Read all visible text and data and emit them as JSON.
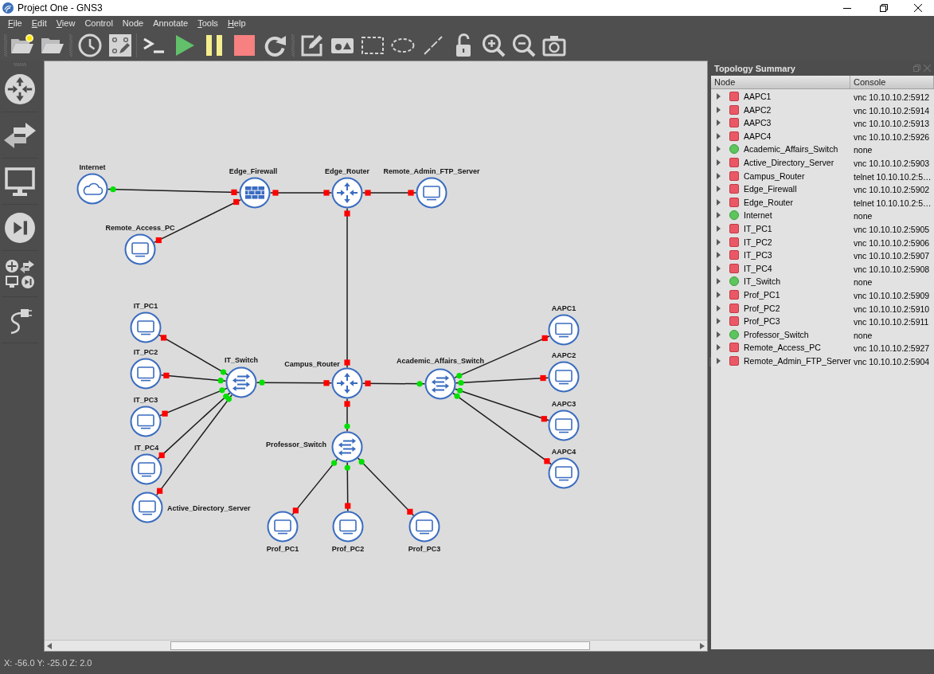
{
  "window": {
    "title": "Project One - GNS3"
  },
  "menu_bar": [
    {
      "label": "File",
      "mnemonic": true
    },
    {
      "label": "Edit",
      "mnemonic": true
    },
    {
      "label": "View",
      "mnemonic": true
    },
    {
      "label": "Control",
      "mnemonic": false
    },
    {
      "label": "Node",
      "mnemonic": false
    },
    {
      "label": "Annotate",
      "mnemonic": false
    },
    {
      "label": "Tools",
      "mnemonic": true
    },
    {
      "label": "Help",
      "mnemonic": true
    }
  ],
  "canvas": {
    "nodes": [
      {
        "name": "Internet",
        "kind": "cloud",
        "running": true,
        "selected": false
      },
      {
        "name": "Edge_Firewall",
        "kind": "firewall",
        "running": false,
        "selected": false
      },
      {
        "name": "Edge_Router",
        "kind": "router",
        "running": false,
        "selected": false
      },
      {
        "name": "Remote_Admin_FTP_Server",
        "kind": "pc",
        "running": false,
        "selected": false
      },
      {
        "name": "Remote_Access_PC",
        "kind": "pc",
        "running": false,
        "selected": false
      },
      {
        "name": "IT_PC1",
        "kind": "pc",
        "running": false,
        "selected": false
      },
      {
        "name": "AAPC1",
        "kind": "pc",
        "running": false,
        "selected": false
      },
      {
        "name": "IT_PC2",
        "kind": "pc",
        "running": false,
        "selected": false
      },
      {
        "name": "AAPC2",
        "kind": "pc",
        "running": false,
        "selected": false
      },
      {
        "name": "IT_Switch",
        "kind": "switch",
        "running": true,
        "selected": false
      },
      {
        "name": "Campus_Router",
        "kind": "router",
        "running": false,
        "selected": false
      },
      {
        "name": "Academic_Affairs_Switch",
        "kind": "switch",
        "running": true,
        "selected": false
      },
      {
        "name": "IT_PC3",
        "kind": "pc",
        "running": false,
        "selected": false
      },
      {
        "name": "AAPC3",
        "kind": "pc",
        "running": false,
        "selected": false
      },
      {
        "name": "Professor_Switch",
        "kind": "switch",
        "running": true,
        "selected": false
      },
      {
        "name": "IT_PC4",
        "kind": "pc",
        "running": false,
        "selected": false
      },
      {
        "name": "AAPC4",
        "kind": "pc",
        "running": false,
        "selected": false
      },
      {
        "name": "Active_Directory_Server",
        "kind": "pc",
        "running": false,
        "selected": false
      },
      {
        "name": "Prof_PC1",
        "kind": "pc",
        "running": false,
        "selected": false
      },
      {
        "name": "Prof_PC2",
        "kind": "pc",
        "running": false,
        "selected": false
      },
      {
        "name": "Prof_PC3",
        "kind": "pc",
        "running": false,
        "selected": false
      }
    ]
  },
  "topology_summary": {
    "title": "Topology Summary",
    "columns": [
      "Node",
      "Console"
    ],
    "rows": [
      {
        "node": "AAPC1",
        "console": "vnc 10.10.10.2:5912",
        "running": false,
        "expanded": false,
        "selected": false
      },
      {
        "node": "AAPC2",
        "console": "vnc 10.10.10.2:5914",
        "running": false,
        "expanded": false,
        "selected": false
      },
      {
        "node": "AAPC3",
        "console": "vnc 10.10.10.2:5913",
        "running": false,
        "expanded": false,
        "selected": false
      },
      {
        "node": "AAPC4",
        "console": "vnc 10.10.10.2:5926",
        "running": false,
        "expanded": false,
        "selected": false
      },
      {
        "node": "Academic_Affairs_Switch",
        "console": "none",
        "running": true,
        "expanded": false,
        "selected": false
      },
      {
        "node": "Active_Directory_Server",
        "console": "vnc 10.10.10.2:5903",
        "running": false,
        "expanded": false,
        "selected": false
      },
      {
        "node": "Campus_Router",
        "console": "telnet 10.10.10.2:5…",
        "running": false,
        "expanded": false,
        "selected": false
      },
      {
        "node": "Edge_Firewall",
        "console": "vnc 10.10.10.2:5902",
        "running": false,
        "expanded": false,
        "selected": false
      },
      {
        "node": "Edge_Router",
        "console": "telnet 10.10.10.2:5…",
        "running": false,
        "expanded": false,
        "selected": false
      },
      {
        "node": "Internet",
        "console": "none",
        "running": true,
        "expanded": false,
        "selected": false
      },
      {
        "node": "IT_PC1",
        "console": "vnc 10.10.10.2:5905",
        "running": false,
        "expanded": false,
        "selected": false
      },
      {
        "node": "IT_PC2",
        "console": "vnc 10.10.10.2:5906",
        "running": false,
        "expanded": false,
        "selected": false
      },
      {
        "node": "IT_PC3",
        "console": "vnc 10.10.10.2:5907",
        "running": false,
        "expanded": false,
        "selected": false
      },
      {
        "node": "IT_PC4",
        "console": "vnc 10.10.10.2:5908",
        "running": false,
        "expanded": false,
        "selected": false
      },
      {
        "node": "IT_Switch",
        "console": "none",
        "running": true,
        "expanded": false,
        "selected": false
      },
      {
        "node": "Prof_PC1",
        "console": "vnc 10.10.10.2:5909",
        "running": false,
        "expanded": false,
        "selected": false
      },
      {
        "node": "Prof_PC2",
        "console": "vnc 10.10.10.2:5910",
        "running": false,
        "expanded": false,
        "selected": false
      },
      {
        "node": "Prof_PC3",
        "console": "vnc 10.10.10.2:5911",
        "running": false,
        "expanded": false,
        "selected": false
      },
      {
        "node": "Professor_Switch",
        "console": "none",
        "running": true,
        "expanded": false,
        "selected": false
      },
      {
        "node": "Remote_Access_PC",
        "console": "vnc 10.10.10.2:5927",
        "running": false,
        "expanded": false,
        "selected": false
      },
      {
        "node": "Remote_Admin_FTP_Server",
        "console": "vnc 10.10.10.2:5904",
        "running": false,
        "expanded": false,
        "selected": false
      }
    ]
  },
  "status_bar": {
    "text": "X: -56.0 Y: -25.0 Z: 2.0"
  }
}
